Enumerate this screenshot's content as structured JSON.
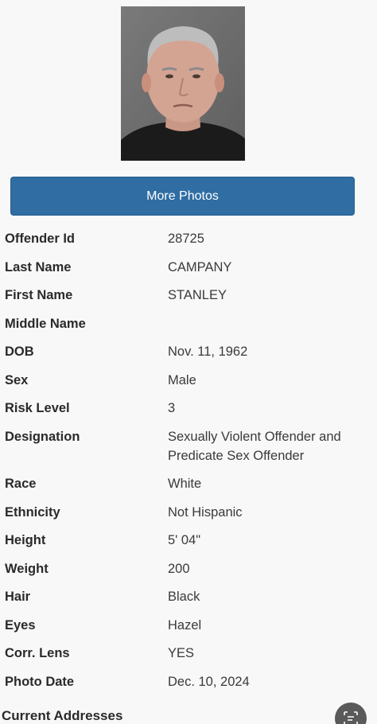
{
  "more_photos_label": "More Photos",
  "details": [
    {
      "label": "Offender Id",
      "value": "28725"
    },
    {
      "label": "Last Name",
      "value": "CAMPANY"
    },
    {
      "label": "First Name",
      "value": "STANLEY"
    },
    {
      "label": "Middle Name",
      "value": ""
    },
    {
      "label": "DOB",
      "value": "Nov. 11, 1962"
    },
    {
      "label": "Sex",
      "value": "Male"
    },
    {
      "label": "Risk Level",
      "value": "3"
    },
    {
      "label": "Designation",
      "value": "Sexually Violent Offender and Predicate Sex Offender"
    },
    {
      "label": "Race",
      "value": "White"
    },
    {
      "label": "Ethnicity",
      "value": "Not Hispanic"
    },
    {
      "label": "Height",
      "value": "5' 04\""
    },
    {
      "label": "Weight",
      "value": "200"
    },
    {
      "label": "Hair",
      "value": "Black"
    },
    {
      "label": "Eyes",
      "value": "Hazel"
    },
    {
      "label": "Corr. Lens",
      "value": "YES"
    },
    {
      "label": "Photo Date",
      "value": "Dec. 10, 2024"
    }
  ],
  "current_addresses_title": "Current Addresses",
  "icons": {
    "fab": "scan-text-icon"
  },
  "colors": {
    "button_bg": "#2f6da3",
    "page_bg": "#f8f8f8"
  }
}
